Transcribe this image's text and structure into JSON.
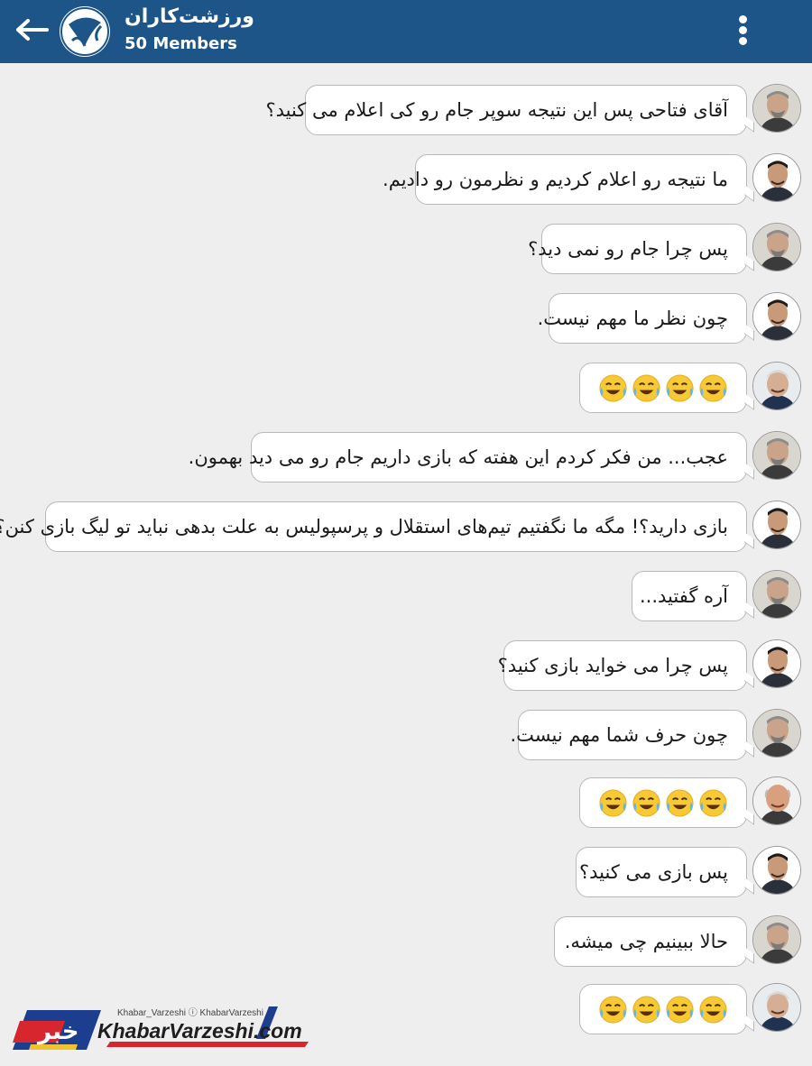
{
  "header": {
    "title": "ورزشت‌کاران",
    "subtitle": "50 Members"
  },
  "messages": [
    {
      "sender": "fatahi",
      "text": "آقای فتاحی پس این نتیجه سوپر جام رو کی اعلام می کنید؟"
    },
    {
      "sender": "sadeghi",
      "text": "ما نتیجه رو اعلام کردیم و نظرمون رو دادیم."
    },
    {
      "sender": "fatahi",
      "text": "پس چرا جام رو نمی دید؟"
    },
    {
      "sender": "sadeghi",
      "text": "چون نظر ما مهم نیست."
    },
    {
      "sender": "taj",
      "emoji": "😂😂😂😂"
    },
    {
      "sender": "fatahi",
      "text": "عجب... من فکر کردم این هفته که بازی داریم جام رو می دید بهمون."
    },
    {
      "sender": "sadeghi",
      "text": "بازی دارید؟! مگه ما نگفتیم تیم‌های استقلال و پرسپولیس به علت بدهی نباید تو لیگ بازی کنن؟"
    },
    {
      "sender": "fatahi",
      "text": "آره گفتید..."
    },
    {
      "sender": "sadeghi",
      "text": "پس چرا می خواید بازی کنید؟"
    },
    {
      "sender": "fatahi",
      "text": "چون حرف شما مهم نیست."
    },
    {
      "sender": "bald",
      "emoji": "😂😂😂😂"
    },
    {
      "sender": "sadeghi",
      "text": "پس بازی می کنید؟"
    },
    {
      "sender": "fatahi",
      "text": "حالا ببینیم چی میشه."
    },
    {
      "sender": "taj",
      "emoji": "😂😂😂😂"
    }
  ],
  "footer": {
    "brand_mark": "خبر",
    "social": "Khabar_Varzeshi  ⓘ KhabarVarzeshi",
    "site": "KhabarVarzeshi.com"
  },
  "colors": {
    "header_bg": "#1d5589",
    "background": "#eeeeee",
    "bubble": "#ffffff",
    "bubble_border": "#b9b9b9",
    "brand_red": "#d7262e",
    "brand_blue": "#1d3d8f"
  }
}
